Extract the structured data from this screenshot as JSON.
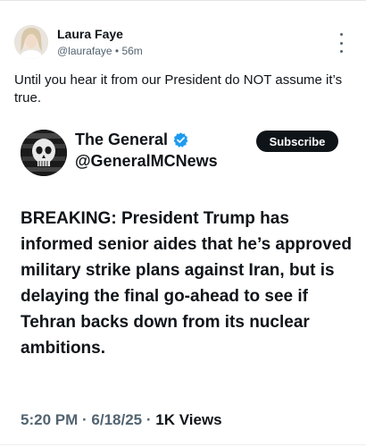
{
  "post": {
    "author_name": "Laura Faye",
    "handle": "@laurafaye",
    "separator": "•",
    "time": "56m",
    "text": "Until you hear it from our President do NOT assume it’s true."
  },
  "quote": {
    "author_name": "The General",
    "handle": "@GeneralMCNews",
    "subscribe_label": "Subscribe",
    "text": "BREAKING: President Trump has informed senior aides that he’s approved military strike plans against Iran, but is delaying the final go-ahead to see if Tehran backs down from its nuclear ambitions.",
    "time": "5:20 PM",
    "date": "6/18/25",
    "dot": "·",
    "views_count": "1K",
    "views_label": "Views"
  },
  "icons": {
    "more": "more-vertical-icon",
    "verified": "verified-badge-icon"
  },
  "colors": {
    "text": "#0f1419",
    "secondary": "#536471",
    "verified": "#1d9bf0",
    "button_bg": "#0f1419"
  }
}
